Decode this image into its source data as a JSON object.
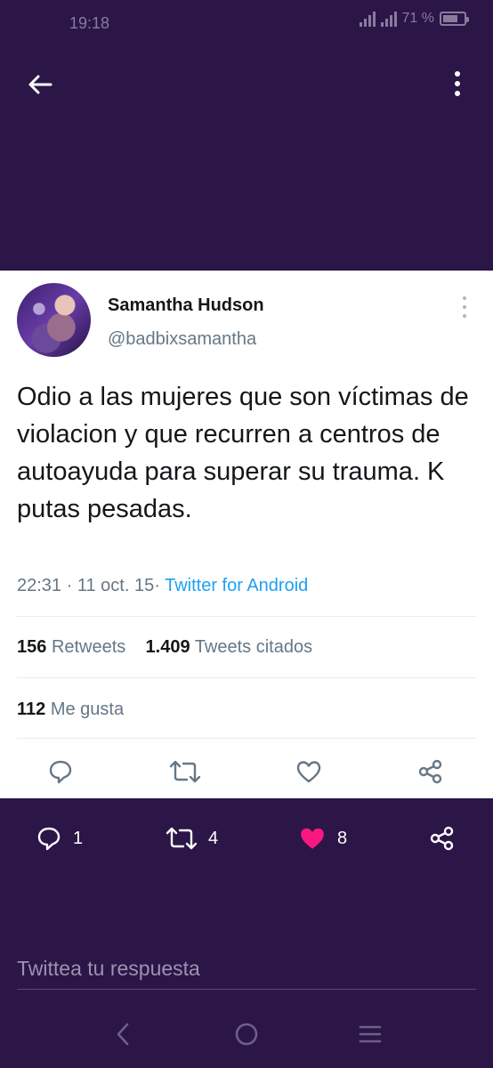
{
  "status_bar": {
    "time": "19:18",
    "battery": "71 %",
    "battery_level": 0.71
  },
  "tweet": {
    "author_name": "Samantha Hudson",
    "author_handle": "@badbixsamantha",
    "text": "Odio a las mujeres que son víctimas de violacion y que recurren a centros de autoayuda para superar su trauma. K putas pesadas.",
    "time": "22:31",
    "date": "11 oct. 15",
    "separator": "·",
    "source": "Twitter for Android",
    "retweets_count": "156",
    "retweets_label": "Retweets",
    "quotes_count": "1.409",
    "quotes_label": "Tweets citados",
    "likes_count": "112",
    "likes_label": "Me gusta"
  },
  "reply_tweet_actions": {
    "replies": "1",
    "retweets": "4",
    "likes": "8"
  },
  "reply_box": {
    "placeholder": "Twittea tu respuesta"
  },
  "colors": {
    "background": "#2b1647",
    "card": "#ffffff",
    "link": "#1da1f2",
    "like": "#f91880"
  },
  "icons": [
    "back-arrow-icon",
    "more-vertical-icon",
    "reply-icon",
    "retweet-icon",
    "like-icon",
    "share-icon",
    "nav-back-icon",
    "nav-home-icon",
    "nav-recents-icon"
  ]
}
